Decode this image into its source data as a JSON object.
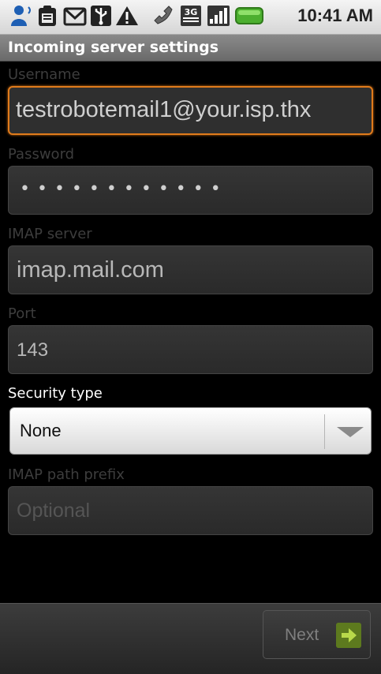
{
  "status_bar": {
    "time": "10:41 AM",
    "network_label": "3G",
    "icons": [
      "people-icon",
      "clipboard-icon",
      "gmail-icon",
      "usb-icon",
      "warning-icon",
      "phone-icon",
      "network-3g-icon",
      "signal-icon",
      "battery-icon"
    ]
  },
  "title": "Incoming server settings",
  "form": {
    "username_label": "Username",
    "username_value": "testrobotemail1@your.isp.thx",
    "password_label": "Password",
    "password_value": "••••••••••••",
    "imap_server_label": "IMAP server",
    "imap_server_value": "imap.mail.com",
    "port_label": "Port",
    "port_value": "143",
    "security_type_label": "Security type",
    "security_type_value": "None",
    "path_prefix_label": "IMAP path prefix",
    "path_prefix_placeholder": "Optional"
  },
  "footer": {
    "next_label": "Next"
  },
  "colors": {
    "focus_accent": "#e07b1c",
    "next_arrow": "#5d7a1e"
  }
}
